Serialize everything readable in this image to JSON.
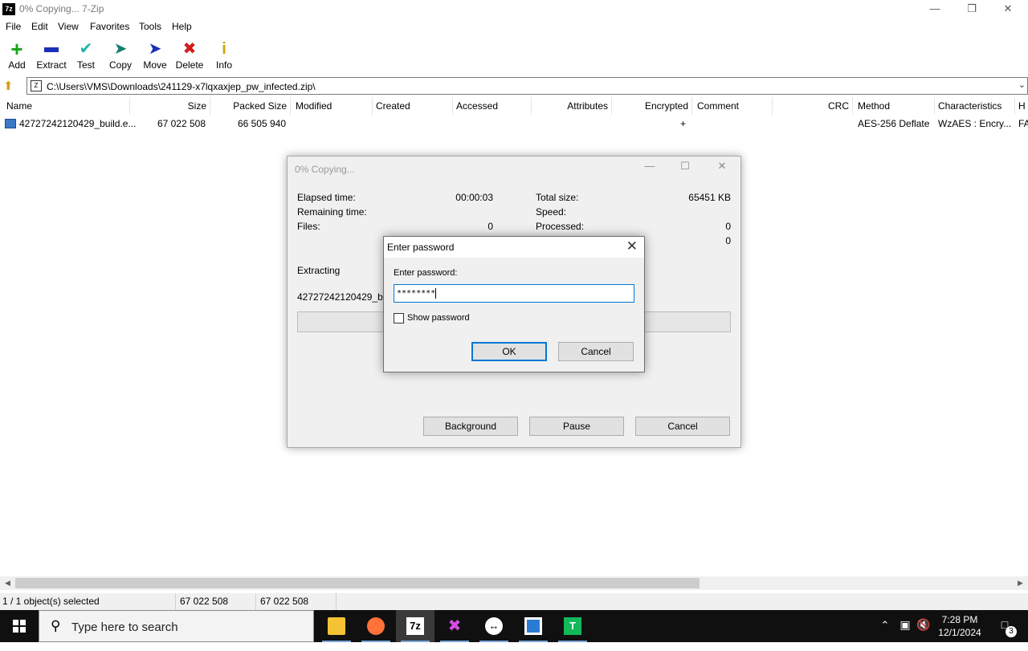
{
  "window": {
    "app_icon": "7z",
    "title": "0% Copying... 7-Zip",
    "minimize_icon": "minimize-icon",
    "restore_icon": "restore-icon",
    "close_icon": "close-icon"
  },
  "menu": [
    "File",
    "Edit",
    "View",
    "Favorites",
    "Tools",
    "Help"
  ],
  "toolbar": [
    {
      "label": "Add",
      "icon": "plus-icon",
      "color": "#1aa31a"
    },
    {
      "label": "Extract",
      "icon": "minus-icon",
      "color": "#1b2fb8"
    },
    {
      "label": "Test",
      "icon": "check-icon",
      "color": "#1cb5a8"
    },
    {
      "label": "Copy",
      "icon": "copy-arrow-icon",
      "color": "#15806e"
    },
    {
      "label": "Move",
      "icon": "move-arrow-icon",
      "color": "#1b2fb8"
    },
    {
      "label": "Delete",
      "icon": "delete-x-icon",
      "color": "#d61b1b"
    },
    {
      "label": "Info",
      "icon": "info-icon",
      "color": "#c9a400"
    }
  ],
  "address": {
    "path": "C:\\Users\\VMS\\Downloads\\241129-x7lqxaxjep_pw_infected.zip\\"
  },
  "columns": [
    "Name",
    "Size",
    "Packed Size",
    "Modified",
    "Created",
    "Accessed",
    "Attributes",
    "Encrypted",
    "Comment",
    "CRC",
    "Method",
    "Characteristics",
    "H"
  ],
  "file": {
    "name": "42727242120429_build.e...",
    "size": "67 022 508",
    "packed_size": "66 505 940",
    "encrypted": "+",
    "method": "AES-256 Deflate",
    "characteristics": "WzAES : Encry...",
    "h": "FA"
  },
  "status": {
    "selected": "1 / 1 object(s) selected",
    "size": "67 022 508",
    "packed": "67 022 508"
  },
  "progress_dialog": {
    "title": "0% Copying...",
    "elapsed_label": "Elapsed time:",
    "elapsed_value": "00:00:03",
    "remaining_label": "Remaining time:",
    "files_label": "Files:",
    "files_value": "0",
    "total_label": "Total size:",
    "total_value": "65451 KB",
    "speed_label": "Speed:",
    "processed_label": "Processed:",
    "processed_value": "0",
    "extra_value": "0",
    "action": "Extracting",
    "current_file": "42727242120429_buil",
    "progress": 0,
    "btn_background": "Background",
    "btn_pause": "Pause",
    "btn_cancel": "Cancel"
  },
  "password_dialog": {
    "title": "Enter password",
    "label": "Enter password:",
    "value": "********",
    "show_password": "Show password",
    "show_password_checked": false,
    "ok": "OK",
    "cancel": "Cancel"
  },
  "taskbar": {
    "search_placeholder": "Type here to search",
    "time": "7:28 PM",
    "date": "12/1/2024",
    "notifications": "3"
  }
}
